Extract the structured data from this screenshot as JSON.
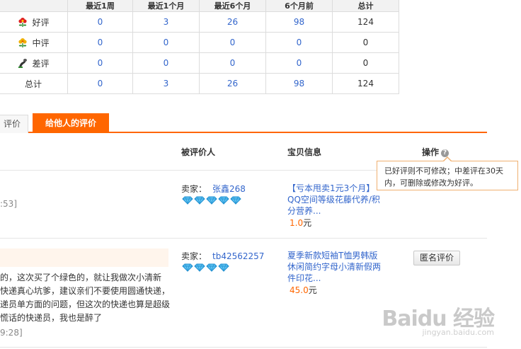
{
  "summary": {
    "headers": [
      "",
      "最近1周",
      "最近1个月",
      "最近6个月",
      "6个月前",
      "总计"
    ],
    "rows": [
      {
        "label": "好评",
        "icon": "red-flower-icon",
        "values": [
          "0",
          "3",
          "26",
          "98",
          "124"
        ]
      },
      {
        "label": "中评",
        "icon": "yellow-flower-icon",
        "values": [
          "0",
          "0",
          "0",
          "0",
          "0"
        ]
      },
      {
        "label": "差评",
        "icon": "black-flower-icon",
        "values": [
          "0",
          "0",
          "0",
          "0",
          "0"
        ]
      },
      {
        "label": "总计",
        "icon": "",
        "values": [
          "0",
          "3",
          "26",
          "98",
          "124"
        ]
      }
    ]
  },
  "tabs": {
    "received": "评价",
    "given": "给他人的评价"
  },
  "list_headers": {
    "target": "被评价人",
    "item": "宝贝信息",
    "action": "操作"
  },
  "tooltip": "已好评则不可修改；中差评在30天内，可删除或修改为好评。",
  "reviews": [
    {
      "time": ":53]",
      "seller_label": "卖家：",
      "seller": "张鑫268",
      "diamonds": 5,
      "item_title": "【亏本甩卖1元3个月】QQ空间等级花藤代养/积分营养...",
      "price": "1.0",
      "currency": "元"
    },
    {
      "time": "9:28]",
      "seller_label": "卖家：",
      "seller": "tb42562257",
      "diamonds": 4,
      "item_title": "夏季新款短袖T恤男韩版休闲简约字母小清新假两件印花...",
      "price": "45.0",
      "currency": "元",
      "comment": "的，这次买了个绿色的，就让我做次小清新\n快递真心坑爹，建议亲们不要使用圆通快递，\n递员单方面的问题，但这次的快递也算是超级\n慌话的快递员，我也是醉了",
      "action": "匿名评价"
    }
  ],
  "watermark": {
    "text": "Baidu 经验",
    "sub": "jingyan.baidu.com"
  }
}
